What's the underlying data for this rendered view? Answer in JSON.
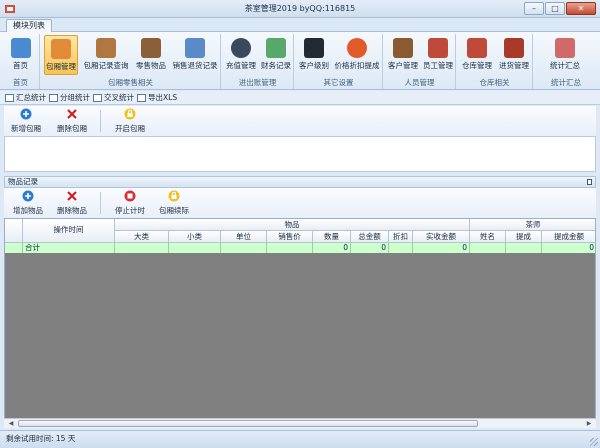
{
  "window": {
    "title": "茶室管理2019 byQQ:116815",
    "minimize": "–",
    "maximize": "□",
    "close": "✕"
  },
  "ribbon_tab": "模块列表",
  "ribbon": {
    "groups": [
      {
        "label": "首页",
        "buttons": [
          {
            "label": "首页",
            "icon": "home-icon",
            "color": "#4a8ad0"
          }
        ]
      },
      {
        "label": "包厢零售相关",
        "buttons": [
          {
            "label": "包厢管理",
            "icon": "room-icon",
            "color": "#e08a3a",
            "active": true
          },
          {
            "label": "包厢记录查询",
            "icon": "book-icon",
            "color": "#b07840"
          },
          {
            "label": "零售物品",
            "icon": "goods-icon",
            "color": "#8a6038"
          },
          {
            "label": "销售退货记录",
            "icon": "return-icon",
            "color": "#5a8ac8"
          }
        ]
      },
      {
        "label": "进出账管理",
        "buttons": [
          {
            "label": "充值管理",
            "icon": "gear-icon",
            "color": "#3a4a5c"
          },
          {
            "label": "财务记录",
            "icon": "finance-icon",
            "color": "#58a86a"
          }
        ]
      },
      {
        "label": "其它设置",
        "buttons": [
          {
            "label": "客户级别",
            "icon": "level-icon",
            "color": "#222a33"
          },
          {
            "label": "价格折扣提成",
            "icon": "discount-icon",
            "color": "#e05a2a"
          }
        ]
      },
      {
        "label": "人员管理",
        "buttons": [
          {
            "label": "客户管理",
            "icon": "customer-icon",
            "color": "#8a5a30"
          },
          {
            "label": "员工管理",
            "icon": "staff-icon",
            "color": "#c04a3a"
          }
        ]
      },
      {
        "label": "仓库相关",
        "buttons": [
          {
            "label": "仓库管理",
            "icon": "warehouse-icon",
            "color": "#c04a3a"
          },
          {
            "label": "进货管理",
            "icon": "purchase-icon",
            "color": "#a83a2a"
          }
        ]
      },
      {
        "label": "统计汇总",
        "buttons": [
          {
            "label": "统计汇总",
            "icon": "chart-icon",
            "color": "#d06a6a"
          }
        ]
      }
    ]
  },
  "quickbar": [
    {
      "label": "汇总统计",
      "icon": "summary-icon"
    },
    {
      "label": "分组统计",
      "icon": "group-icon"
    },
    {
      "label": "交叉统计",
      "icon": "cross-icon"
    },
    {
      "label": "导出XLS",
      "icon": "export-icon"
    }
  ],
  "pack_toolbar": {
    "add": "新增包厢",
    "delete": "删除包厢",
    "open": "开启包厢"
  },
  "goods_section": {
    "title": "物品记录",
    "toolbar": {
      "add": "增加物品",
      "delete": "删除物品",
      "stop": "停止计时",
      "renew": "包厢续际"
    }
  },
  "grid": {
    "op_time": "操作时间",
    "group_goods": "物品",
    "group_staff": "茶师",
    "columns": [
      "大类",
      "小类",
      "单位",
      "销售价",
      "数量",
      "总金额",
      "折扣",
      "实收金额",
      "姓名",
      "提成",
      "提成金额"
    ],
    "total_row": {
      "label": "合计",
      "qty": "0",
      "total": "0",
      "received": "0",
      "commission": "0"
    }
  },
  "status": {
    "trial": "剩余试用时间:   15 天"
  },
  "colors": {
    "accent": "#f9c453",
    "total_row": "#ceffce",
    "grid_bg": "#808080"
  }
}
